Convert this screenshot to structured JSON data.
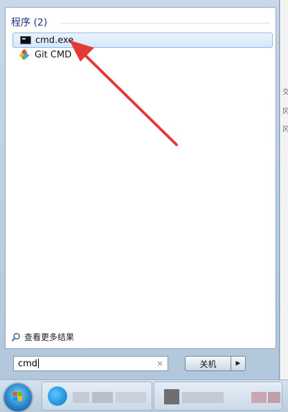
{
  "results": {
    "section_title": "程序 (2)",
    "items": [
      {
        "label": "cmd.exe",
        "icon": "cmd-icon",
        "selected": true
      },
      {
        "label": "Git CMD",
        "icon": "git-icon",
        "selected": false
      }
    ]
  },
  "see_more": {
    "label": "查看更多结果",
    "icon": "search-icon"
  },
  "search": {
    "value": "cmd",
    "clear_icon": "×"
  },
  "shutdown": {
    "label": "关机",
    "arrow": "▶"
  },
  "background_glyphs": [
    "交",
    "冈",
    "冈"
  ],
  "colors": {
    "accent_arrow": "#e53935",
    "section_title": "#1e3287",
    "selection_border": "#8fb4e2"
  }
}
